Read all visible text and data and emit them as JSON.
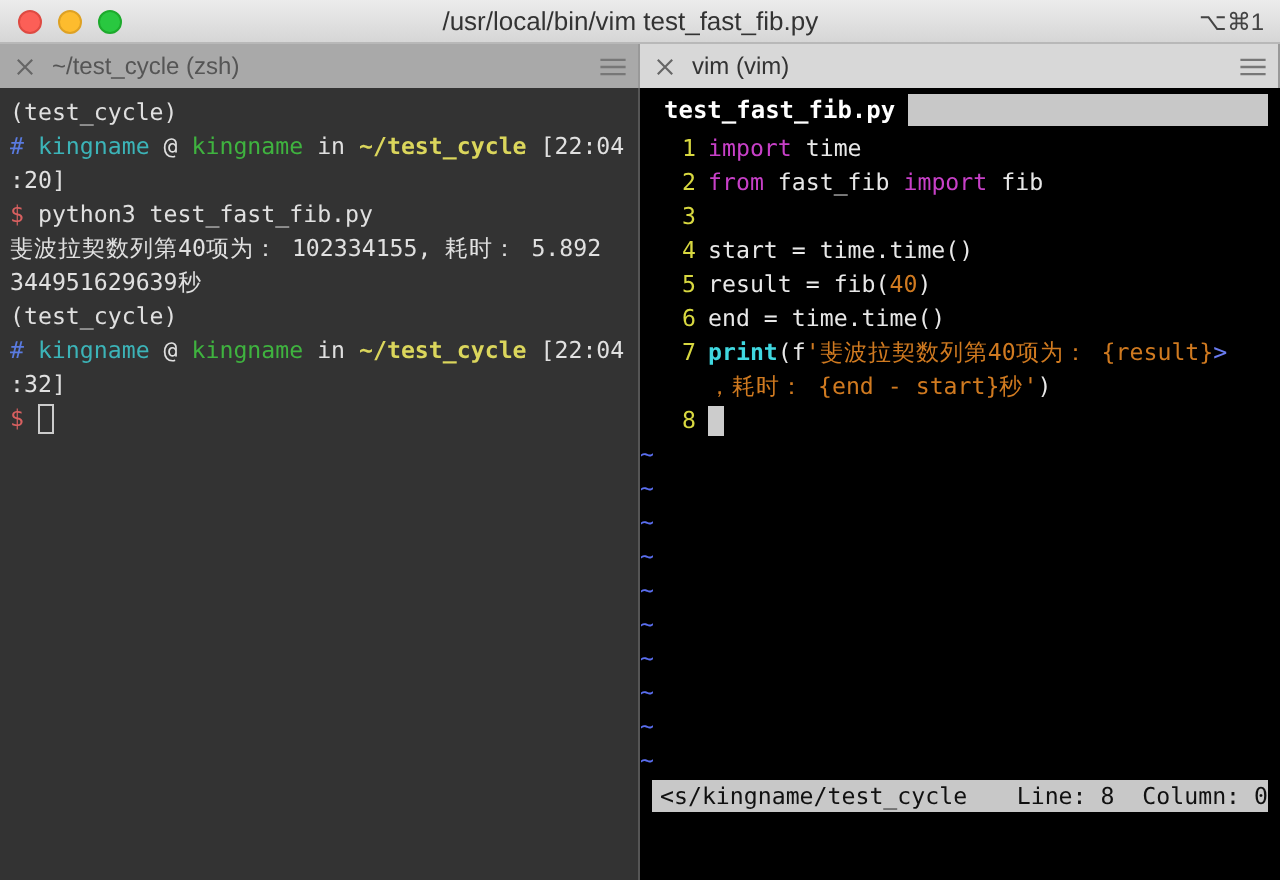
{
  "window": {
    "title": "/usr/local/bin/vim test_fast_fib.py",
    "shortcut": "⌥⌘1"
  },
  "tabs": [
    {
      "label": "~/test_cycle (zsh)",
      "selected": false
    },
    {
      "label": "vim (vim)",
      "selected": true
    }
  ],
  "shell": {
    "lines": [
      {
        "segments": [
          {
            "text": "(test_cycle)",
            "kind": "plain"
          }
        ]
      },
      {
        "segments": [
          {
            "text": "#",
            "kind": "hash"
          },
          {
            "text": "kingname",
            "kind": "user"
          },
          {
            "text": " @ ",
            "kind": "plain"
          },
          {
            "text": "kingname",
            "kind": "host"
          },
          {
            "text": " in ",
            "kind": "plain"
          },
          {
            "text": "~/test_cycle",
            "kind": "path"
          },
          {
            "text": " [22:04",
            "kind": "plain"
          }
        ]
      },
      {
        "segments": [
          {
            "text": ":20]",
            "kind": "plain"
          }
        ]
      },
      {
        "segments": [
          {
            "text": "$",
            "kind": "dollar"
          },
          {
            "text": " python3 test_fast_fib.py",
            "kind": "plain"
          }
        ]
      },
      {
        "segments": [
          {
            "text": "斐波拉契数列第40项为： 102334155, 耗时： 5.892",
            "kind": "plain"
          }
        ]
      },
      {
        "segments": [
          {
            "text": "344951629639秒",
            "kind": "plain"
          }
        ]
      },
      {
        "segments": [
          {
            "text": "(test_cycle)",
            "kind": "plain"
          }
        ]
      },
      {
        "segments": [
          {
            "text": "#",
            "kind": "hash"
          },
          {
            "text": "kingname",
            "kind": "user"
          },
          {
            "text": " @ ",
            "kind": "plain"
          },
          {
            "text": "kingname",
            "kind": "host"
          },
          {
            "text": " in ",
            "kind": "plain"
          },
          {
            "text": "~/test_cycle",
            "kind": "path"
          },
          {
            "text": " [22:04",
            "kind": "plain"
          }
        ]
      },
      {
        "segments": [
          {
            "text": ":32]",
            "kind": "plain"
          }
        ]
      },
      {
        "segments": [
          {
            "text": "$",
            "kind": "dollar"
          }
        ],
        "cursor": true
      }
    ]
  },
  "vim": {
    "file_tab": "test_fast_fib.py",
    "lines": [
      {
        "number": "1",
        "segments": [
          {
            "text": "import",
            "kind": "keyword"
          },
          {
            "text": " time",
            "kind": "plain"
          }
        ]
      },
      {
        "number": "2",
        "segments": [
          {
            "text": "from",
            "kind": "keyword"
          },
          {
            "text": " fast_fib ",
            "kind": "plain"
          },
          {
            "text": "import",
            "kind": "keyword"
          },
          {
            "text": " fib",
            "kind": "plain"
          }
        ]
      },
      {
        "number": "3"
      },
      {
        "number": "4",
        "segments": [
          {
            "text": "start = time.time()",
            "kind": "plain"
          }
        ]
      },
      {
        "number": "5",
        "segments": [
          {
            "text": "result = fib(",
            "kind": "plain"
          },
          {
            "text": "40",
            "kind": "number"
          },
          {
            "text": ")",
            "kind": "plain"
          }
        ]
      },
      {
        "number": "6",
        "segments": [
          {
            "text": "end = time.time()",
            "kind": "plain"
          }
        ]
      },
      {
        "number": "7",
        "segments": [
          {
            "text": "print",
            "kind": "builtin"
          },
          {
            "text": "(f",
            "kind": "plain"
          },
          {
            "text": "'斐波拉契数列第40项为： {result}",
            "kind": "string"
          },
          {
            "text": ">",
            "kind": "wrapmark"
          }
        ]
      },
      {
        "segments": [
          {
            "text": "，耗时： {end - start}秒'",
            "kind": "string"
          },
          {
            "text": ")",
            "kind": "plain"
          }
        ]
      },
      {
        "number": "8",
        "cursor": true
      }
    ],
    "tildes": [
      "~",
      "~",
      "~",
      "~",
      "~",
      "~",
      "~",
      "~",
      "~",
      "~"
    ],
    "status": {
      "path": "<s/kingname/test_cycle",
      "position": "Line: 8  Column: 0"
    }
  }
}
